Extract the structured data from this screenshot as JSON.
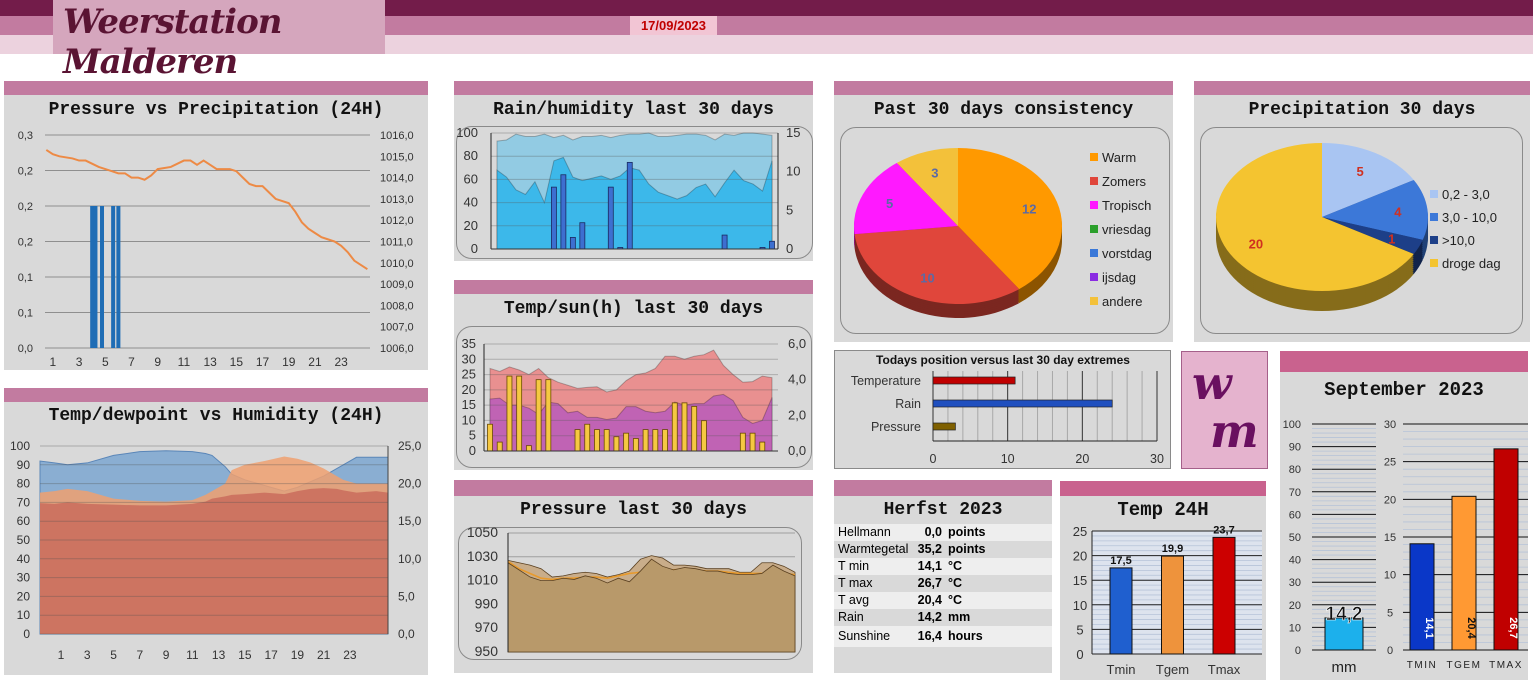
{
  "header": {
    "title": "Weerstation Malderen",
    "date": "17/09/2023"
  },
  "logo": {
    "line1": "w",
    "line2": "m"
  },
  "herfst": {
    "title": "Herfst 2023",
    "rows": [
      {
        "label": "Hellmann",
        "value": "0,0",
        "unit": "points"
      },
      {
        "label": "Warmtegetal",
        "value": "35,2",
        "unit": "points"
      },
      {
        "label": "T min",
        "value": "14,1",
        "unit": "°C"
      },
      {
        "label": "T max",
        "value": "26,7",
        "unit": "°C"
      },
      {
        "label": "T avg",
        "value": "20,4",
        "unit": "°C"
      },
      {
        "label": "Rain",
        "value": "14,2",
        "unit": "mm"
      },
      {
        "label": "Sunshine",
        "value": "16,4",
        "unit": "hours"
      }
    ]
  },
  "chart_data": [
    {
      "id": "pressure24",
      "type": "bar+line",
      "title": "Pressure vs Precipitation (24H)",
      "xticks": [
        1,
        3,
        5,
        7,
        9,
        11,
        13,
        15,
        17,
        19,
        21,
        23
      ],
      "xlim": [
        0.4,
        25.2
      ],
      "yleft": {
        "lim": [
          0,
          0.3
        ],
        "ticks": [
          0,
          0.05,
          0.1,
          0.15,
          0.2,
          0.25,
          0.3
        ],
        "labels": [
          "0,0",
          "0,1",
          "0,1",
          "0,2",
          "0,2",
          "0,2",
          "0,3"
        ]
      },
      "yright": {
        "lim": [
          1006,
          1016
        ],
        "ticks": [
          1006,
          1007,
          1008,
          1009,
          1010,
          1011,
          1012,
          1013,
          1014,
          1015,
          1016
        ],
        "labels": [
          "1006,0",
          "1007,0",
          "1008,0",
          "1009,0",
          "1010,0",
          "1011,0",
          "1012,0",
          "1013,0",
          "1014,0",
          "1015,0",
          "1016,0"
        ]
      },
      "precip": {
        "name": "Precipitation",
        "color": "#1f6db5",
        "x": [
          4.0,
          4.25,
          4.75,
          5.6,
          6.0
        ],
        "values": [
          0.2,
          0.2,
          0.2,
          0.2,
          0.2
        ]
      },
      "pressure": {
        "name": "Pressure",
        "color": "#ed8a45",
        "x": [
          0.5,
          1,
          1.5,
          2.5,
          3,
          3.5,
          4.5,
          5,
          5.5,
          6,
          6.5,
          7,
          7.5,
          8,
          8.5,
          9,
          10,
          11,
          11.5,
          12,
          12.5,
          13,
          13.5,
          14.5,
          15,
          15.5,
          16,
          16.5,
          17,
          17.5,
          18,
          19,
          19.5,
          20,
          20.5,
          21,
          21.5,
          22,
          22.5,
          23,
          23.5,
          24,
          24.5,
          25
        ],
        "values": [
          1015.3,
          1015.1,
          1015.0,
          1014.9,
          1014.8,
          1014.8,
          1014.5,
          1014.4,
          1014.3,
          1014.2,
          1014.2,
          1014.0,
          1014.0,
          1013.9,
          1014.1,
          1014.4,
          1014.5,
          1014.8,
          1014.8,
          1014.6,
          1014.8,
          1014.6,
          1014.4,
          1014.4,
          1014.3,
          1014.0,
          1013.7,
          1013.6,
          1013.6,
          1013.3,
          1013.0,
          1012.8,
          1012.4,
          1011.9,
          1011.6,
          1011.4,
          1011.2,
          1011.1,
          1011.0,
          1010.8,
          1010.5,
          1010.1,
          1009.9,
          1009.7
        ]
      }
    },
    {
      "id": "tempdew24",
      "type": "area",
      "title": "Temp/dewpoint vs Humidity (24H)",
      "xticks": [
        1,
        3,
        5,
        7,
        9,
        11,
        13,
        15,
        17,
        19,
        21,
        23
      ],
      "xlim": [
        -0.6,
        25.9
      ],
      "yleft": {
        "lim": [
          0,
          100
        ],
        "ticks": [
          0,
          10,
          20,
          30,
          40,
          50,
          60,
          70,
          80,
          90,
          100
        ],
        "labels": [
          "0",
          "10",
          "20",
          "30",
          "40",
          "50",
          "60",
          "70",
          "80",
          "90",
          "100"
        ]
      },
      "yright": {
        "lim": [
          0,
          25
        ],
        "ticks": [
          0,
          5,
          10,
          15,
          20,
          25
        ],
        "labels": [
          "0,0",
          "5,0",
          "10,0",
          "15,0",
          "20,0",
          "25,0"
        ]
      },
      "x": [
        -0.6,
        0.5,
        1.5,
        3,
        5,
        7,
        9,
        11,
        12,
        12.5,
        13.5,
        14,
        15,
        16.5,
        18,
        19,
        20,
        21,
        22,
        22.5,
        23.5,
        25,
        25.9
      ],
      "series": [
        {
          "name": "Humidity",
          "axis": "left",
          "color": "#86acd2",
          "values": [
            92,
            91,
            90,
            91,
            95,
            97,
            97.5,
            97,
            96,
            95,
            89,
            85,
            82,
            79,
            76,
            78,
            81,
            84,
            88,
            90,
            94,
            94,
            94
          ]
        },
        {
          "name": "Temperature",
          "axis": "right",
          "color": "#eea070",
          "values": [
            18.8,
            19,
            19.3,
            19,
            18,
            17.7,
            17.6,
            17.8,
            18.5,
            19,
            20,
            21.8,
            22.5,
            23,
            23.6,
            23.3,
            22.8,
            22,
            21,
            20.5,
            20,
            20,
            20
          ]
        },
        {
          "name": "Dewpoint",
          "axis": "right",
          "color": "#cb7260",
          "values": [
            17.4,
            17.3,
            17.5,
            17.3,
            17.2,
            17.1,
            17.1,
            17.3,
            17.6,
            18,
            18.3,
            18.5,
            18.6,
            18.8,
            18.6,
            19,
            19.3,
            19.4,
            19.3,
            19.1,
            18.8,
            19,
            18.8
          ]
        }
      ]
    },
    {
      "id": "rainhum30",
      "type": "area+bar",
      "title": "Rain/humidity last 30 days",
      "yleft": {
        "lim": [
          0,
          100
        ],
        "ticks": [
          0,
          20,
          40,
          60,
          80,
          100
        ],
        "labels": [
          "0",
          "20",
          "40",
          "60",
          "80",
          "100"
        ]
      },
      "yright": {
        "lim": [
          0,
          15
        ],
        "ticks": [
          0,
          5,
          10,
          15
        ],
        "labels": [
          "0",
          "5",
          "10",
          "15"
        ]
      },
      "series": [
        {
          "name": "Humidity max",
          "color": "#92cbe3",
          "values": [
            93,
            94,
            99,
            97,
            97,
            99,
            96,
            98,
            94,
            97,
            97,
            98,
            96,
            98,
            99,
            99,
            100,
            97,
            97,
            98,
            99,
            99,
            98,
            94,
            99,
            98,
            100,
            100,
            99,
            98
          ]
        },
        {
          "name": "Humidity min",
          "color": "#3cb8ea",
          "values": [
            68,
            62,
            51,
            47,
            58,
            40,
            76,
            79,
            62,
            59,
            61,
            63,
            60,
            63,
            70,
            68,
            56,
            49,
            46,
            43,
            46,
            53,
            56,
            45,
            57,
            68,
            59,
            56,
            50,
            76
          ]
        }
      ],
      "rain": {
        "name": "Rain",
        "color": "#3d6fd0",
        "values": [
          0,
          0,
          0,
          0,
          0,
          0,
          8,
          9.6,
          1.5,
          3.4,
          0,
          0,
          8,
          0.2,
          11.2,
          0,
          0,
          0,
          0,
          0,
          0,
          0,
          0,
          0,
          1.8,
          0,
          0,
          0,
          0.2,
          1
        ]
      }
    },
    {
      "id": "tempsun30",
      "type": "area+bar",
      "title": "Temp/sun(h) last 30 days",
      "yleft": {
        "lim": [
          0,
          35
        ],
        "ticks": [
          0,
          5,
          10,
          15,
          20,
          25,
          30,
          35
        ],
        "labels": [
          "0",
          "5",
          "10",
          "15",
          "20",
          "25",
          "30",
          "35"
        ]
      },
      "yright": {
        "lim": [
          0,
          6
        ],
        "ticks": [
          0,
          2,
          4,
          6
        ],
        "labels": [
          "0,0",
          "2,0",
          "4,0",
          "6,0"
        ]
      },
      "series": [
        {
          "name": "Tmax",
          "color": "#e99090",
          "values": [
            27,
            26,
            27.5,
            26.5,
            25,
            27,
            24,
            22.5,
            21.5,
            20.5,
            20.8,
            21,
            19.3,
            20,
            23,
            25,
            25.5,
            27,
            31,
            31,
            30,
            31,
            31.5,
            33,
            28,
            25,
            22.5,
            22.7,
            24.5,
            24
          ]
        },
        {
          "name": "Tmin",
          "color": "#c063b4",
          "values": [
            17,
            17.3,
            15,
            15,
            14,
            12,
            16,
            15.5,
            12.5,
            13,
            11,
            11,
            10.3,
            10.8,
            14.5,
            14.5,
            13,
            12.5,
            13,
            16,
            15,
            15.5,
            15.5,
            18,
            18.5,
            16.5,
            11,
            9,
            10,
            17.5
          ]
        }
      ],
      "sun": {
        "name": "Sun hours",
        "color": "#f5c842",
        "values": [
          1.5,
          0.5,
          4.2,
          4.2,
          0.3,
          4,
          4,
          0,
          0,
          1.2,
          1.5,
          1.2,
          1.2,
          0.8,
          1,
          0.7,
          1.2,
          1.2,
          1.2,
          2.7,
          2.7,
          2.5,
          1.7,
          0,
          0,
          0,
          1,
          1,
          0.5,
          0
        ]
      }
    },
    {
      "id": "pressure30",
      "type": "area",
      "title": "Pressure last 30 days",
      "yleft": {
        "lim": [
          950,
          1050
        ],
        "ticks": [
          950,
          970,
          990,
          1010,
          1030,
          1050
        ],
        "labels": [
          "950",
          "970",
          "990",
          "1010",
          "1030",
          "1050"
        ]
      },
      "series": [
        {
          "name": "Pressure max",
          "color": "#c9ad8a",
          "values": [
            1027,
            1025,
            1023,
            1020,
            1013,
            1014,
            1016,
            1017,
            1016,
            1013,
            1015,
            1018,
            1028,
            1031,
            1029,
            1023,
            1023,
            1022,
            1020,
            1020,
            1020,
            1017,
            1017,
            1025,
            1025,
            1022,
            1017
          ]
        },
        {
          "name": "Pressure avg",
          "color": "#e89a2c",
          "values": [
            1026,
            1020,
            1016,
            1012,
            1011,
            1012,
            1012,
            1013,
            1013,
            1012,
            1014,
            1016,
            1017,
            1019,
            1019,
            1019,
            1020,
            1019,
            1018,
            1018,
            1017,
            1016,
            1016,
            1016,
            1016,
            1016,
            1015
          ]
        },
        {
          "name": "Pressure min",
          "color": "#b8996a",
          "values": [
            1025,
            1019,
            1013,
            1010,
            1010,
            1012,
            1011,
            1014,
            1012,
            1008,
            1012,
            1009,
            1018,
            1028,
            1022,
            1019,
            1021,
            1020,
            1018,
            1018,
            1016,
            1015,
            1015,
            1016,
            1023,
            1018,
            1014
          ]
        }
      ]
    },
    {
      "id": "consistency",
      "type": "pie",
      "title": "Past 30 days consistency",
      "categories": [
        "Warm",
        "Zomers",
        "Tropisch",
        "vriesdag",
        "vorstdag",
        "ijsdag",
        "andere"
      ],
      "values": [
        12,
        10,
        5,
        0,
        0,
        0,
        3
      ],
      "colors": [
        "#ff9900",
        "#e0463b",
        "#ff19ff",
        "#2ca02c",
        "#3a78d8",
        "#8a2be2",
        "#f3c13a"
      ],
      "label_color": "#5b6aa5",
      "legend": "right"
    },
    {
      "id": "precip30",
      "type": "pie",
      "title": "Precipitation 30 days",
      "categories": [
        "0,2 - 3,0",
        "3,0 - 10,0",
        ">10,0",
        "droge dag"
      ],
      "values": [
        5,
        4,
        1,
        20
      ],
      "colors": [
        "#a9c5f2",
        "#3c78d8",
        "#1d3f88",
        "#f4c430"
      ],
      "label_color": "#d03020",
      "legend": "right"
    },
    {
      "id": "todaypos",
      "type": "hbar",
      "title": "Todays position versus last 30 day extremes",
      "categories": [
        "Temperature",
        "Rain",
        "Pressure"
      ],
      "values": [
        11,
        24,
        3
      ],
      "colors": [
        "#c00000",
        "#1f4fbf",
        "#7f6000"
      ],
      "xlim": [
        0,
        30
      ],
      "xticks": [
        0,
        10,
        20,
        30
      ]
    },
    {
      "id": "temp24",
      "type": "bar",
      "title": "Temp 24H",
      "categories": [
        "Tmin",
        "Tgem",
        "Tmax"
      ],
      "values": [
        17.5,
        19.9,
        23.7
      ],
      "labels": [
        "17,5",
        "19,9",
        "23,7"
      ],
      "colors": [
        "#1f5fcf",
        "#ee933c",
        "#cc0000"
      ],
      "ylim": [
        0,
        25
      ],
      "yticks": [
        0,
        5,
        10,
        15,
        20,
        25
      ]
    },
    {
      "id": "september",
      "type": "bar",
      "title": "September 2023",
      "rain": {
        "value": 14.2,
        "label": "14,2",
        "unit": "mm",
        "color": "#1cb0ec",
        "ylim": [
          0,
          100
        ],
        "yticks": [
          0,
          10,
          20,
          30,
          40,
          50,
          60,
          70,
          80,
          90,
          100
        ]
      },
      "categories": [
        "TMIN",
        "TGEM",
        "TMAX"
      ],
      "values": [
        14.1,
        20.4,
        26.7
      ],
      "labels": [
        "14,1",
        "20,4",
        "26,7"
      ],
      "colors": [
        "#0a37c8",
        "#ff9933",
        "#c00000"
      ],
      "ylim": [
        0,
        30
      ],
      "yticks": [
        0,
        5,
        10,
        15,
        20,
        25,
        30
      ]
    }
  ]
}
